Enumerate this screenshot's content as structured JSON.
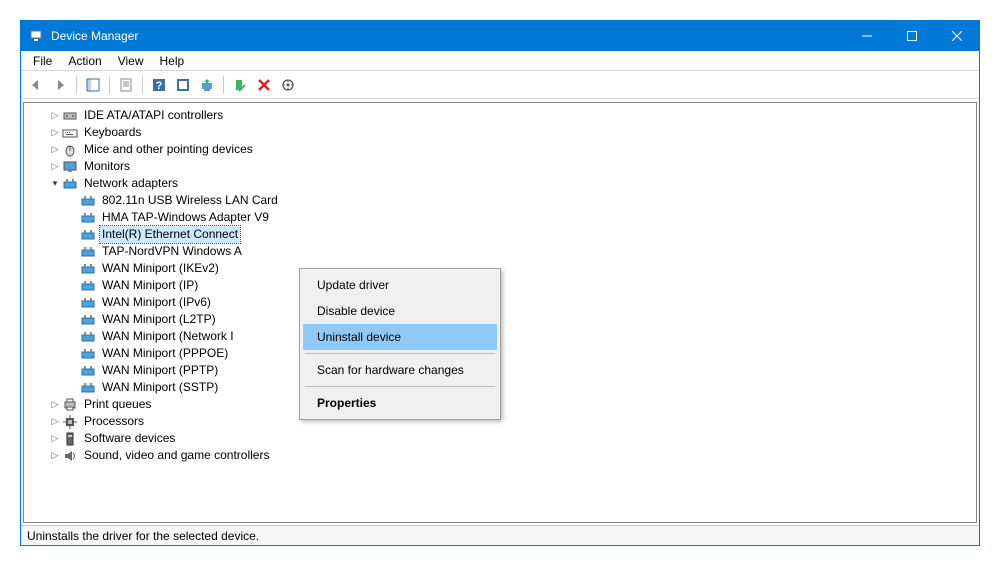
{
  "window": {
    "title": "Device Manager"
  },
  "menubar": {
    "file": "File",
    "action": "Action",
    "view": "View",
    "help": "Help"
  },
  "tree": {
    "ide": "IDE ATA/ATAPI controllers",
    "keyboards": "Keyboards",
    "mice": "Mice and other pointing devices",
    "monitors": "Monitors",
    "network": "Network adapters",
    "net_items": {
      "wifi": "802.11n USB Wireless LAN Card",
      "hma": "HMA TAP-Windows Adapter V9",
      "intel": "Intel(R) Ethernet Connect",
      "nordvpn": "TAP-NordVPN Windows A",
      "ikev2": "WAN Miniport (IKEv2)",
      "ip": "WAN Miniport (IP)",
      "ipv6": "WAN Miniport (IPv6)",
      "l2tp": "WAN Miniport (L2TP)",
      "netmon": "WAN Miniport (Network I",
      "pppoe": "WAN Miniport (PPPOE)",
      "pptp": "WAN Miniport (PPTP)",
      "sstp": "WAN Miniport (SSTP)"
    },
    "print": "Print queues",
    "processors": "Processors",
    "software": "Software devices",
    "sound": "Sound, video and game controllers"
  },
  "context_menu": {
    "update": "Update driver",
    "disable": "Disable device",
    "uninstall": "Uninstall device",
    "scan": "Scan for hardware changes",
    "properties": "Properties"
  },
  "status": "Uninstalls the driver for the selected device."
}
